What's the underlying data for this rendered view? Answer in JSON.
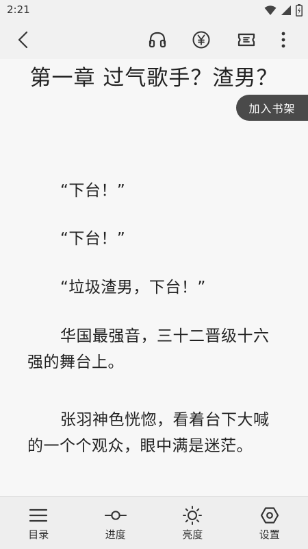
{
  "status_bar": {
    "time": "2:21",
    "icons": [
      "wifi-icon",
      "signal-icon",
      "battery-icon"
    ]
  },
  "toolbar": {
    "icons": [
      "back-icon",
      "headphones-icon",
      "yen-icon",
      "ticket-icon",
      "more-icon"
    ]
  },
  "chapter": {
    "title": "第一章 过气歌手？渣男？",
    "add_to_shelf": "加入书架",
    "paragraphs": [
      "“下台！”",
      "“下台！”",
      "“垃圾渣男，下台！”",
      "华国最强音，三十二晋级十六强的舞台上。",
      "张羽神色恍惚，看着台下大喊的一个个观众，眼中满是迷茫。"
    ]
  },
  "bottom_nav": {
    "items": [
      {
        "label": "目录",
        "icon": "catalog-icon"
      },
      {
        "label": "进度",
        "icon": "progress-icon"
      },
      {
        "label": "亮度",
        "icon": "brightness-icon"
      },
      {
        "label": "设置",
        "icon": "settings-icon"
      }
    ]
  },
  "colors": {
    "background": "#f7f7f7",
    "bar": "#f1f1f1",
    "shelf_button": "#4a4a4a",
    "text": "#222222"
  }
}
